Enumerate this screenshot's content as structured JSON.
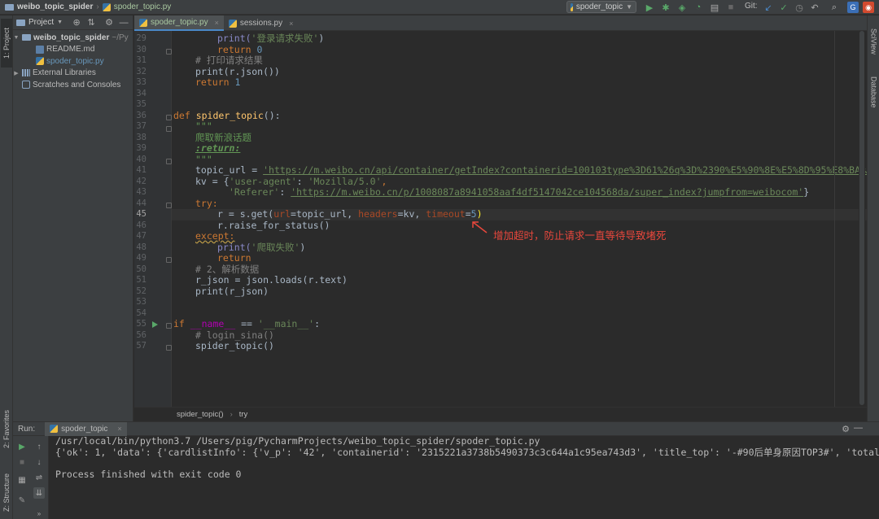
{
  "navbar": {
    "project": "weibo_topic_spider",
    "file": "spoder_topic.py",
    "run_config": "spoder_topic",
    "git_label": "Git:"
  },
  "left_strip": {
    "project_tab": "1: Project",
    "favorites_tab": "2: Favorites",
    "structure_tab": "Z: Structure"
  },
  "right_strip": {
    "sciview": "SciView",
    "database": "Database"
  },
  "project_panel": {
    "title": "Project",
    "tree": [
      {
        "label": "weibo_topic_spider",
        "suffix": "~/Py",
        "kind": "folder",
        "expanded": true
      },
      {
        "label": "README.md",
        "kind": "md"
      },
      {
        "label": "spoder_topic.py",
        "kind": "py",
        "selected": true
      },
      {
        "label": "External Libraries",
        "kind": "lib"
      },
      {
        "label": "Scratches and Consoles",
        "kind": "scratch"
      }
    ]
  },
  "editor_tabs": [
    {
      "label": "spoder_topic.py",
      "active": true
    },
    {
      "label": "sessions.py",
      "active": false
    }
  ],
  "editor": {
    "line_numbers": [
      "29",
      "30",
      "31",
      "32",
      "33",
      "34",
      "35",
      "36",
      "37",
      "38",
      "39",
      "40",
      "41",
      "42",
      "43",
      "44",
      "45",
      "46",
      "47",
      "48",
      "49",
      "50",
      "51",
      "52",
      "53",
      "54",
      "55",
      "56",
      "57"
    ],
    "current_line": "45",
    "annotation": "增加超时，防止请求一直等待导致堵死",
    "code": {
      "l29a": "print(",
      "l29b": "'登录请求失败'",
      "l29c": ")",
      "l30a": "return ",
      "l30b": "0",
      "l31": "# 打印请求结果",
      "l32": "print(r.json())",
      "l33a": "return ",
      "l33b": "1",
      "l36a": "def ",
      "l36b": "spider_topic",
      "l36c": "():",
      "l37": "\"\"\"",
      "l38": "爬取新浪话题",
      "l39": ":return:",
      "l40": "\"\"\"",
      "l41a": "topic_url = ",
      "l41b": "'https://m.weibo.cn/api/container/getIndex?containerid=100103type%3D61%26q%3D%2390%E5%90%8E%E5%8D%95%E8%BA%AB%",
      "l42a": "kv = {",
      "l42b": "'user-agent'",
      "l42c": ": ",
      "l42d": "'Mozilla/5.0'",
      "l42e": ",",
      "l43a": "'Referer'",
      "l43b": ": ",
      "l43c": "'https://m.weibo.cn/p/1008087a8941058aaf4df5147042ce104568da/super_index?jumpfrom=weibocom'",
      "l43d": "}",
      "l44": "try:",
      "l45a": "r = s.get(",
      "l45b": "url",
      "l45c": "=topic_url, ",
      "l45d": "headers",
      "l45e": "=kv, ",
      "l45f": "timeout",
      "l45g": "=",
      "l45h": "5",
      "l45i": ")",
      "l46": "r.raise_for_status()",
      "l47": "except:",
      "l48a": "print(",
      "l48b": "'爬取失败'",
      "l48c": ")",
      "l49": "return",
      "l50": "# 2、解析数据",
      "l51": "r_json = json.loads(r.text)",
      "l52": "print(r_json)",
      "l55a": "if ",
      "l55b": "__name__",
      "l55c": " == ",
      "l55d": "'__main__'",
      "l55e": ":",
      "l56": "# login_sina()",
      "l57": "spider_topic()"
    },
    "breadcrumb": [
      "spider_topic()",
      "try"
    ]
  },
  "run_panel": {
    "label": "Run:",
    "tab": "spoder_topic",
    "console": [
      "/usr/local/bin/python3.7 /Users/pig/PycharmProjects/weibo_topic_spider/spoder_topic.py",
      "{'ok': 1, 'data': {'cardlistInfo': {'v_p': '42', 'containerid': '2315221a3738b5490373c3c644a1c95ea743d3', 'title_top': '-#90后单身原因TOP3#', 'total'",
      "",
      "Process finished with exit code 0"
    ]
  },
  "colors": {
    "background": "#2b2b2b",
    "keyword": "#cc7832",
    "string": "#6a8759",
    "annotation": "#e8473c"
  }
}
